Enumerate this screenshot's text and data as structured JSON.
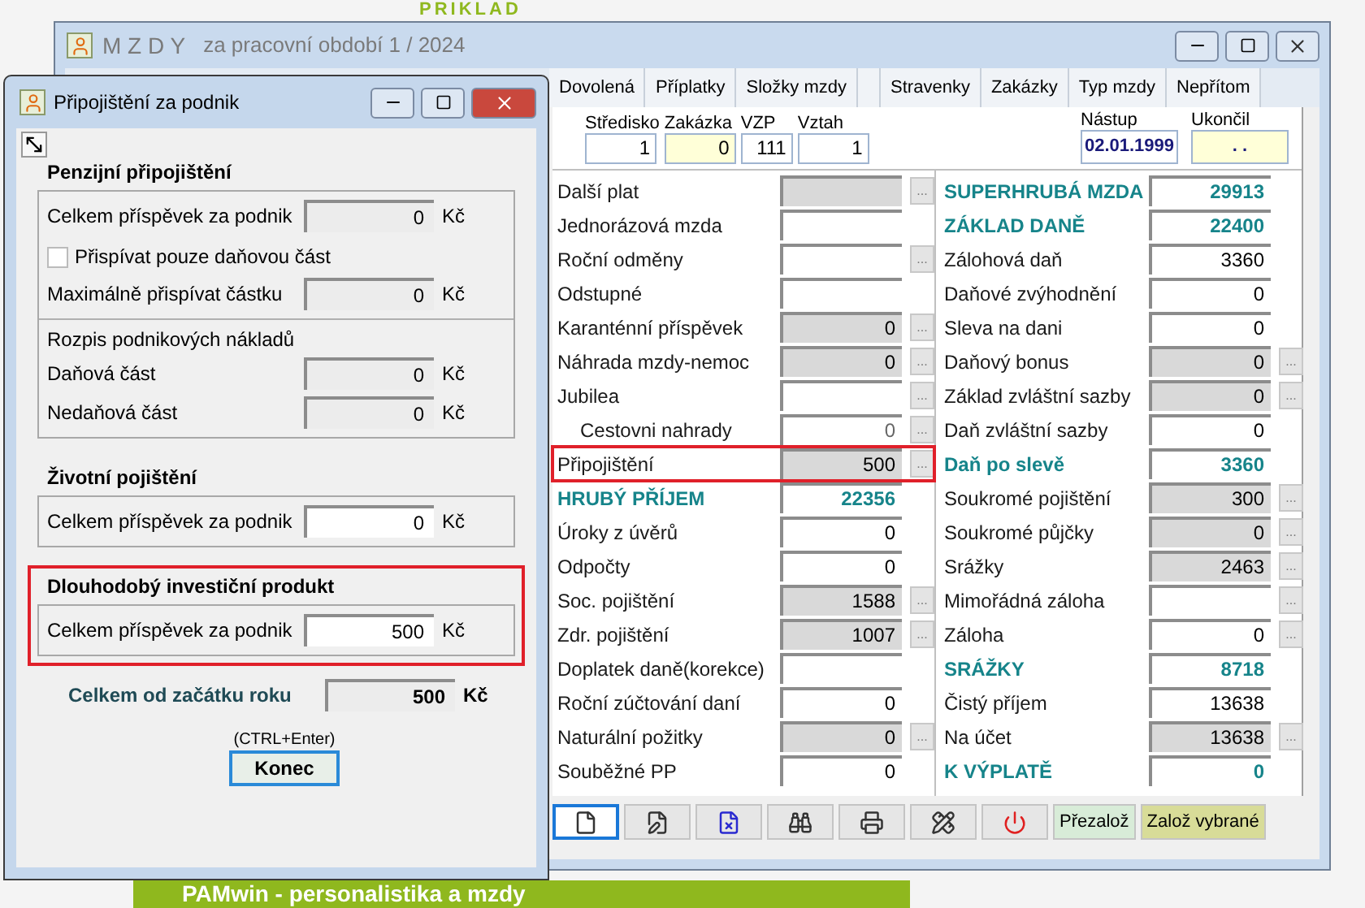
{
  "backdrop": {
    "heading": "PRIKLAD",
    "banner": "PAMwin - personalistika a mzdy"
  },
  "main_window": {
    "title": "M Z D Y",
    "subtitle": "za pracovní období  1 / 2024",
    "tabs": [
      {
        "label": "Dovolená",
        "selected": false
      },
      {
        "label": "Příplatky",
        "selected": false
      },
      {
        "label": "Složky mzdy",
        "selected": false
      },
      {
        "selected": false
      },
      {
        "label": "Stravenky",
        "selected": false
      },
      {
        "label": "Zakázky",
        "selected": false
      },
      {
        "label": "Typ mzdy",
        "selected": false
      },
      {
        "label": "Nepřítom",
        "selected": false
      }
    ],
    "header_fields": [
      {
        "label": "Středisko",
        "value": "1",
        "color": "#ffffff"
      },
      {
        "label": "Zakázka",
        "value": "0",
        "color": "#ffffd8"
      },
      {
        "label": "VZP",
        "value": "111",
        "color": "#ffffff"
      },
      {
        "label": "Vztah",
        "value": "1",
        "color": "#ffffff"
      }
    ],
    "dates": [
      {
        "label": "Nástup",
        "value": "02.01.1999",
        "color": "#ffffff"
      },
      {
        "label": "Ukončil",
        "value": ". .",
        "color": "#ffffd8"
      }
    ],
    "left_rows": [
      {
        "label": "Další plat",
        "readonly": true,
        "emphasis": false,
        "highlighted": false,
        "more": "...",
        "indented": false
      },
      {
        "label": "Jednorázová mzda",
        "readonly": false,
        "emphasis": false,
        "highlighted": false,
        "indented": false
      },
      {
        "label": "Roční odměny",
        "readonly": false,
        "emphasis": false,
        "highlighted": false,
        "more": "...",
        "indented": false
      },
      {
        "label": "Odstupné",
        "readonly": false,
        "emphasis": false,
        "highlighted": false,
        "indented": false
      },
      {
        "label": "Karanténní příspěvek",
        "value": "0",
        "readonly": true,
        "emphasis": false,
        "highlighted": false,
        "more": "...",
        "indented": false
      },
      {
        "label": "Náhrada mzdy-nemoc",
        "value": "0",
        "readonly": true,
        "emphasis": false,
        "highlighted": false,
        "more": "...",
        "indented": false
      },
      {
        "label": "Jubilea",
        "readonly": false,
        "emphasis": false,
        "highlighted": false,
        "more": "...",
        "indented": false
      },
      {
        "label": "Cestovni nahrady",
        "value": "0",
        "readonly": false,
        "emphasis": false,
        "highlighted": false,
        "more": "...",
        "indented": true
      },
      {
        "label": "Připojištění",
        "value": "500",
        "readonly": true,
        "emphasis": false,
        "highlighted": true,
        "more": "...",
        "indented": false
      },
      {
        "label": "HRUBÝ PŘÍJEM",
        "value": "22356",
        "readonly": false,
        "emphasis": true,
        "highlighted": false,
        "indented": false
      },
      {
        "label": "Úroky z úvěrů",
        "value": "0",
        "readonly": false,
        "emphasis": false,
        "highlighted": false,
        "indented": false
      },
      {
        "label": "Odpočty",
        "value": "0",
        "readonly": false,
        "emphasis": false,
        "highlighted": false,
        "indented": false
      },
      {
        "label": "Soc. pojištění",
        "value": "1588",
        "readonly": true,
        "emphasis": false,
        "highlighted": false,
        "more": "...",
        "indented": false
      },
      {
        "label": "Zdr. pojištění",
        "value": "1007",
        "readonly": true,
        "emphasis": false,
        "highlighted": false,
        "more": "...",
        "indented": false
      },
      {
        "label": "Doplatek daně(korekce)",
        "readonly": false,
        "emphasis": false,
        "highlighted": false,
        "indented": false
      },
      {
        "label": "Roční zúčtování daní",
        "value": "0",
        "readonly": false,
        "emphasis": false,
        "highlighted": false,
        "indented": false
      },
      {
        "label": "Naturální požitky",
        "value": "0",
        "readonly": true,
        "emphasis": false,
        "highlighted": false,
        "more": "...",
        "indented": false
      },
      {
        "label": "Souběžné PP",
        "value": "0",
        "readonly": false,
        "emphasis": false,
        "highlighted": false,
        "indented": false
      }
    ],
    "right_rows": [
      {
        "label": "SUPERHRUBÁ MZDA",
        "value": "29913",
        "readonly": false,
        "emphasis": true,
        "highlighted": false
      },
      {
        "label": "ZÁKLAD DANĚ",
        "value": "22400",
        "readonly": false,
        "emphasis": true,
        "highlighted": false
      },
      {
        "label": "Zálohová daň",
        "value": "3360",
        "readonly": false,
        "emphasis": false,
        "highlighted": false
      },
      {
        "label": "Daňové zvýhodnění",
        "value": "0",
        "readonly": false,
        "emphasis": false,
        "highlighted": false
      },
      {
        "label": "Sleva na dani",
        "value": "0",
        "readonly": false,
        "emphasis": false,
        "highlighted": false
      },
      {
        "label": "Daňový bonus",
        "value": "0",
        "readonly": true,
        "emphasis": false,
        "highlighted": false,
        "more": "..."
      },
      {
        "label": "Základ zvláštní sazby",
        "value": "0",
        "readonly": true,
        "emphasis": false,
        "highlighted": false,
        "more": "..."
      },
      {
        "label": "Daň zvláštní sazby",
        "value": "0",
        "readonly": false,
        "emphasis": false,
        "highlighted": false
      },
      {
        "label": "Daň po slevě",
        "value": "3360",
        "readonly": false,
        "emphasis": true,
        "highlighted": false
      },
      {
        "label": "Soukromé pojištění",
        "value": "300",
        "readonly": true,
        "emphasis": false,
        "highlighted": false,
        "more": "..."
      },
      {
        "label": "Soukromé půjčky",
        "value": "0",
        "readonly": true,
        "emphasis": false,
        "highlighted": false,
        "more": "..."
      },
      {
        "label": "Srážky",
        "value": "2463",
        "readonly": true,
        "emphasis": false,
        "highlighted": false,
        "more": "..."
      },
      {
        "label": "Mimořádná záloha",
        "readonly": false,
        "emphasis": false,
        "highlighted": false,
        "more": "..."
      },
      {
        "label": "Záloha",
        "value": "0",
        "readonly": false,
        "emphasis": false,
        "highlighted": false,
        "more": "..."
      },
      {
        "label": "SRÁŽKY",
        "value": "8718",
        "readonly": false,
        "emphasis": true,
        "highlighted": false
      },
      {
        "label": "Čistý příjem",
        "value": "13638",
        "readonly": false,
        "emphasis": false,
        "highlighted": false
      },
      {
        "label": "Na účet",
        "value": "13638",
        "readonly": true,
        "emphasis": false,
        "highlighted": false,
        "more": "..."
      },
      {
        "label": "K VÝPLATĚ",
        "value": "0",
        "readonly": false,
        "emphasis": true,
        "highlighted": false
      }
    ],
    "toolbar_buttons": [
      {
        "focused": true
      },
      {
        "focused": false
      },
      {
        "focused": false
      },
      {
        "focused": false
      },
      {
        "focused": false
      },
      {
        "focused": false
      },
      {
        "focused": false
      }
    ],
    "action_buttons": [
      {
        "label": "Přezalož",
        "color": "#d8ecd8"
      },
      {
        "label": "Založ vybrané",
        "color": "#d8dc98"
      }
    ]
  },
  "dialog": {
    "title": "Připojištění za podnik",
    "sections": [
      {
        "heading": "Penzijní připojištění",
        "highlighted": false,
        "items": [
          {
            "kind": "field",
            "label": "Celkem příspěvek za podnik",
            "value": "0",
            "unit": "Kč",
            "readonly": true
          },
          {
            "kind": "checkbox",
            "label": "Přispívat pouze daňovou část",
            "checked": false
          },
          {
            "kind": "field",
            "label": "Maximálně přispívat částku",
            "value": "0",
            "unit": "Kč",
            "readonly": true
          },
          {
            "kind": "divider"
          },
          {
            "kind": "caption",
            "label": "Rozpis podnikových nákladů"
          },
          {
            "kind": "field",
            "label": "Daňová část",
            "value": "0",
            "unit": "Kč",
            "readonly": true
          },
          {
            "kind": "field",
            "label": "Nedaňová část",
            "value": "0",
            "unit": "Kč",
            "readonly": true
          }
        ]
      },
      {
        "heading": "Životní  pojištění",
        "highlighted": false,
        "items": [
          {
            "kind": "field",
            "label": "Celkem příspěvek za podnik",
            "value": "0",
            "unit": "Kč",
            "readonly": false
          }
        ]
      },
      {
        "heading": "Dlouhodobý investiční produkt",
        "highlighted": true,
        "items": [
          {
            "kind": "field",
            "label": "Celkem příspěvek za podnik",
            "value": "500",
            "unit": "Kč",
            "readonly": false
          }
        ]
      }
    ],
    "total": {
      "label": "Celkem od začátku roku",
      "value": "500",
      "unit": "Kč"
    },
    "shortcut": "(CTRL+Enter)",
    "close_button": "Konec"
  }
}
